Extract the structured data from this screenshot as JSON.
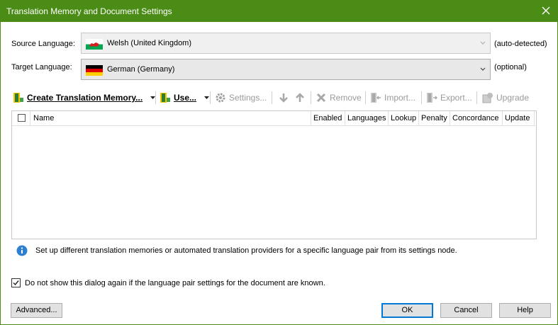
{
  "window": {
    "title": "Translation Memory and Document Settings"
  },
  "source": {
    "label": "Source Language:",
    "value": "Welsh (United Kingdom)",
    "hint": "(auto-detected)",
    "flag": "wales-flag-icon"
  },
  "target": {
    "label": "Target Language:",
    "value": "German (Germany)",
    "hint": "(optional)",
    "flag": "germany-flag-icon"
  },
  "toolbar": {
    "create": "Create Translation Memory...",
    "use": "Use...",
    "settings": "Settings...",
    "remove": "Remove",
    "import": "Import...",
    "export": "Export...",
    "upgrade": "Upgrade"
  },
  "grid": {
    "columns": [
      "Name",
      "Enabled",
      "Languages",
      "Lookup",
      "Penalty",
      "Concordance",
      "Update"
    ],
    "rows": []
  },
  "info": "Set up different translation memories or automated translation providers for a specific language pair from its settings node.",
  "dont_show": {
    "label": "Do not show this dialog again if the language pair settings for the document are known.",
    "checked": true
  },
  "buttons": {
    "advanced": "Advanced...",
    "ok": "OK",
    "cancel": "Cancel",
    "help": "Help"
  },
  "colors": {
    "titlebar": "#4a8c16",
    "accent": "#0078d7"
  }
}
